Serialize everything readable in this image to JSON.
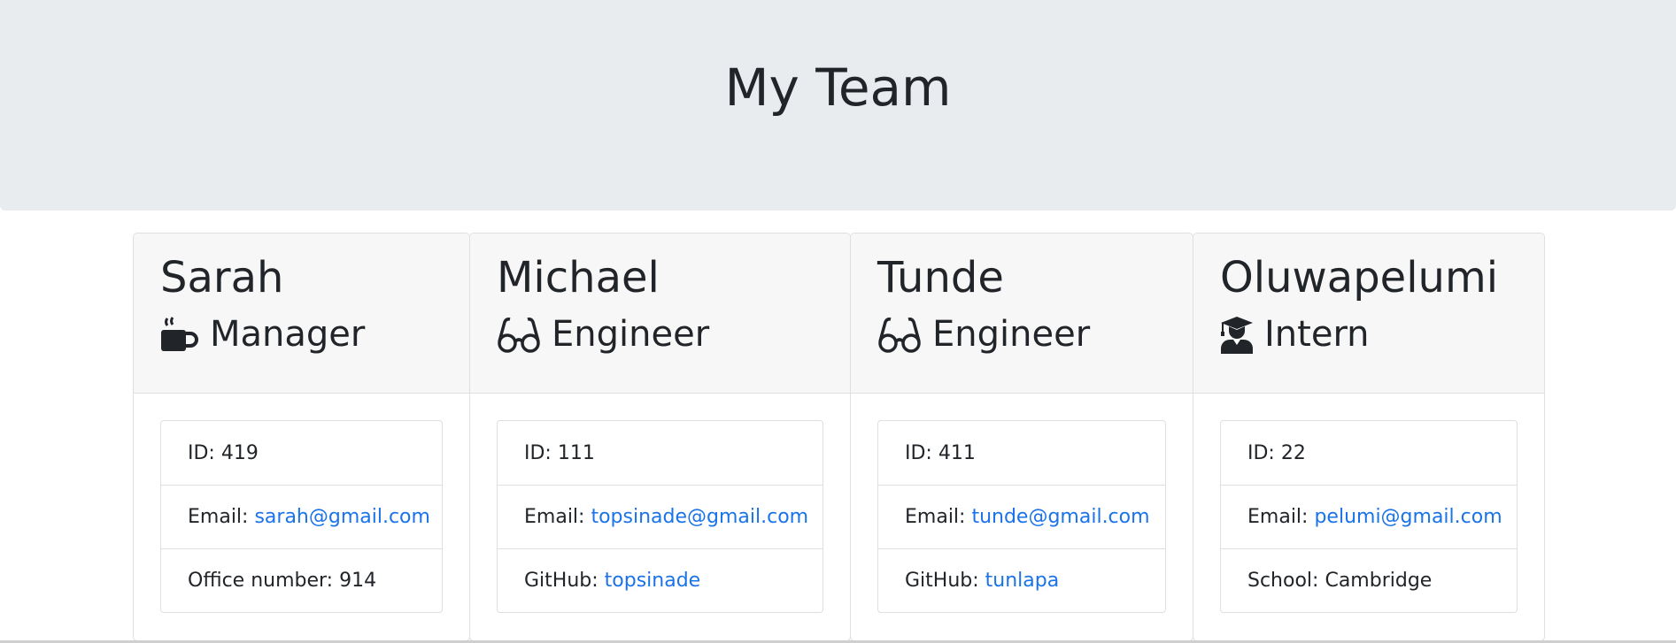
{
  "header": {
    "title": "My Team"
  },
  "colors": {
    "jumbotron_bg": "#e9ecef",
    "link": "#1a73e8",
    "card_header_bg": "#f7f7f7"
  },
  "members": [
    {
      "name": "Sarah",
      "role": "Manager",
      "role_icon": "coffee-mug-icon",
      "id_label": "ID:",
      "id": "419",
      "email_label": "Email:",
      "email": "sarah@gmail.com",
      "extra_label": "Office number:",
      "extra_value": "914"
    },
    {
      "name": "Michael",
      "role": "Engineer",
      "role_icon": "glasses-icon",
      "id_label": "ID:",
      "id": "111",
      "email_label": "Email:",
      "email": "topsinade@gmail.com",
      "extra_label": "GitHub:",
      "extra_value": "topsinade"
    },
    {
      "name": "Tunde",
      "role": "Engineer",
      "role_icon": "glasses-icon",
      "id_label": "ID:",
      "id": "411",
      "email_label": "Email:",
      "email": "tunde@gmail.com",
      "extra_label": "GitHub:",
      "extra_value": "tunlapa"
    },
    {
      "name": "Oluwapelumi",
      "role": "Intern",
      "role_icon": "graduate-icon",
      "id_label": "ID:",
      "id": "22",
      "email_label": "Email:",
      "email": "pelumi@gmail.com",
      "extra_label": "School:",
      "extra_value": "Cambridge"
    }
  ]
}
